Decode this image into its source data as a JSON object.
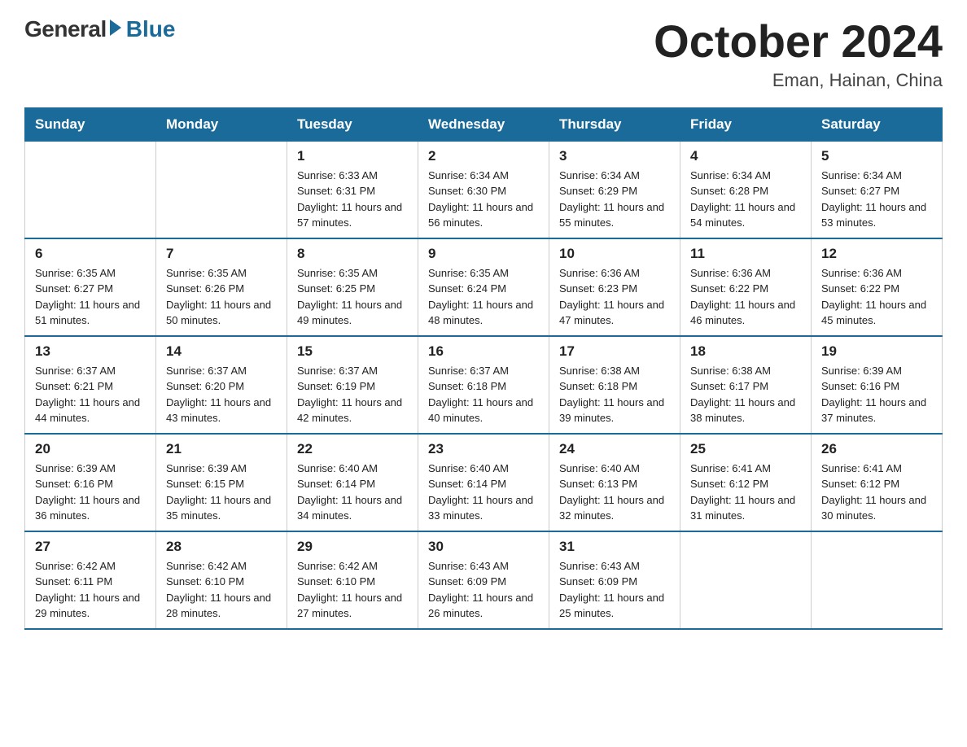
{
  "header": {
    "logo_general": "General",
    "logo_blue": "Blue",
    "month_title": "October 2024",
    "location": "Eman, Hainan, China"
  },
  "days_of_week": [
    "Sunday",
    "Monday",
    "Tuesday",
    "Wednesday",
    "Thursday",
    "Friday",
    "Saturday"
  ],
  "weeks": [
    [
      {
        "day": "",
        "info": ""
      },
      {
        "day": "",
        "info": ""
      },
      {
        "day": "1",
        "info": "Sunrise: 6:33 AM\nSunset: 6:31 PM\nDaylight: 11 hours\nand 57 minutes."
      },
      {
        "day": "2",
        "info": "Sunrise: 6:34 AM\nSunset: 6:30 PM\nDaylight: 11 hours\nand 56 minutes."
      },
      {
        "day": "3",
        "info": "Sunrise: 6:34 AM\nSunset: 6:29 PM\nDaylight: 11 hours\nand 55 minutes."
      },
      {
        "day": "4",
        "info": "Sunrise: 6:34 AM\nSunset: 6:28 PM\nDaylight: 11 hours\nand 54 minutes."
      },
      {
        "day": "5",
        "info": "Sunrise: 6:34 AM\nSunset: 6:27 PM\nDaylight: 11 hours\nand 53 minutes."
      }
    ],
    [
      {
        "day": "6",
        "info": "Sunrise: 6:35 AM\nSunset: 6:27 PM\nDaylight: 11 hours\nand 51 minutes."
      },
      {
        "day": "7",
        "info": "Sunrise: 6:35 AM\nSunset: 6:26 PM\nDaylight: 11 hours\nand 50 minutes."
      },
      {
        "day": "8",
        "info": "Sunrise: 6:35 AM\nSunset: 6:25 PM\nDaylight: 11 hours\nand 49 minutes."
      },
      {
        "day": "9",
        "info": "Sunrise: 6:35 AM\nSunset: 6:24 PM\nDaylight: 11 hours\nand 48 minutes."
      },
      {
        "day": "10",
        "info": "Sunrise: 6:36 AM\nSunset: 6:23 PM\nDaylight: 11 hours\nand 47 minutes."
      },
      {
        "day": "11",
        "info": "Sunrise: 6:36 AM\nSunset: 6:22 PM\nDaylight: 11 hours\nand 46 minutes."
      },
      {
        "day": "12",
        "info": "Sunrise: 6:36 AM\nSunset: 6:22 PM\nDaylight: 11 hours\nand 45 minutes."
      }
    ],
    [
      {
        "day": "13",
        "info": "Sunrise: 6:37 AM\nSunset: 6:21 PM\nDaylight: 11 hours\nand 44 minutes."
      },
      {
        "day": "14",
        "info": "Sunrise: 6:37 AM\nSunset: 6:20 PM\nDaylight: 11 hours\nand 43 minutes."
      },
      {
        "day": "15",
        "info": "Sunrise: 6:37 AM\nSunset: 6:19 PM\nDaylight: 11 hours\nand 42 minutes."
      },
      {
        "day": "16",
        "info": "Sunrise: 6:37 AM\nSunset: 6:18 PM\nDaylight: 11 hours\nand 40 minutes."
      },
      {
        "day": "17",
        "info": "Sunrise: 6:38 AM\nSunset: 6:18 PM\nDaylight: 11 hours\nand 39 minutes."
      },
      {
        "day": "18",
        "info": "Sunrise: 6:38 AM\nSunset: 6:17 PM\nDaylight: 11 hours\nand 38 minutes."
      },
      {
        "day": "19",
        "info": "Sunrise: 6:39 AM\nSunset: 6:16 PM\nDaylight: 11 hours\nand 37 minutes."
      }
    ],
    [
      {
        "day": "20",
        "info": "Sunrise: 6:39 AM\nSunset: 6:16 PM\nDaylight: 11 hours\nand 36 minutes."
      },
      {
        "day": "21",
        "info": "Sunrise: 6:39 AM\nSunset: 6:15 PM\nDaylight: 11 hours\nand 35 minutes."
      },
      {
        "day": "22",
        "info": "Sunrise: 6:40 AM\nSunset: 6:14 PM\nDaylight: 11 hours\nand 34 minutes."
      },
      {
        "day": "23",
        "info": "Sunrise: 6:40 AM\nSunset: 6:14 PM\nDaylight: 11 hours\nand 33 minutes."
      },
      {
        "day": "24",
        "info": "Sunrise: 6:40 AM\nSunset: 6:13 PM\nDaylight: 11 hours\nand 32 minutes."
      },
      {
        "day": "25",
        "info": "Sunrise: 6:41 AM\nSunset: 6:12 PM\nDaylight: 11 hours\nand 31 minutes."
      },
      {
        "day": "26",
        "info": "Sunrise: 6:41 AM\nSunset: 6:12 PM\nDaylight: 11 hours\nand 30 minutes."
      }
    ],
    [
      {
        "day": "27",
        "info": "Sunrise: 6:42 AM\nSunset: 6:11 PM\nDaylight: 11 hours\nand 29 minutes."
      },
      {
        "day": "28",
        "info": "Sunrise: 6:42 AM\nSunset: 6:10 PM\nDaylight: 11 hours\nand 28 minutes."
      },
      {
        "day": "29",
        "info": "Sunrise: 6:42 AM\nSunset: 6:10 PM\nDaylight: 11 hours\nand 27 minutes."
      },
      {
        "day": "30",
        "info": "Sunrise: 6:43 AM\nSunset: 6:09 PM\nDaylight: 11 hours\nand 26 minutes."
      },
      {
        "day": "31",
        "info": "Sunrise: 6:43 AM\nSunset: 6:09 PM\nDaylight: 11 hours\nand 25 minutes."
      },
      {
        "day": "",
        "info": ""
      },
      {
        "day": "",
        "info": ""
      }
    ]
  ]
}
